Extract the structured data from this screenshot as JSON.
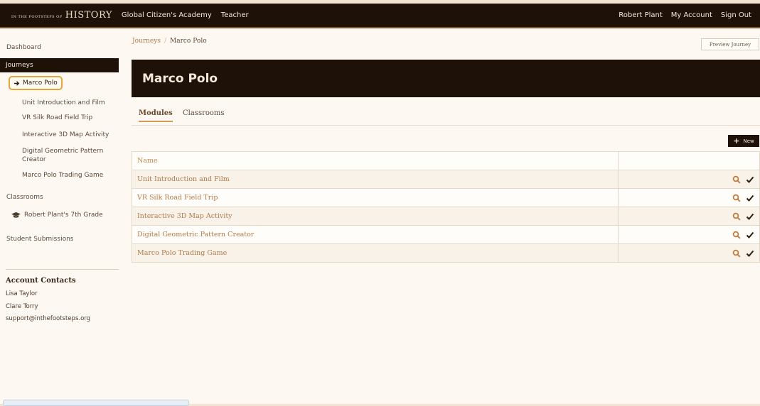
{
  "nav": {
    "brand_small": "In The Footsteps Of",
    "brand_big": "History",
    "school": "Global Citizen's Academy",
    "role": "Teacher",
    "user": "Robert Plant",
    "my_account": "My Account",
    "sign_out": "Sign Out"
  },
  "sidebar": {
    "dashboard": "Dashboard",
    "journeys": "Journeys",
    "active_journey": "Marco Polo",
    "journey_items": [
      "Unit Introduction and Film",
      "VR Silk Road Field Trip",
      "Interactive 3D Map Activity",
      "Digital Geometric Pattern Creator",
      "Marco Polo Trading Game"
    ],
    "classrooms": "Classrooms",
    "classroom": "Robert Plant's 7th Grade",
    "submissions": "Student Submissions",
    "contacts_title": "Account Contacts",
    "contacts": [
      "Lisa Taylor",
      "Clare Torry",
      "support@inthefootsteps.org"
    ]
  },
  "breadcrumb": {
    "parent": "Journeys",
    "separator": "/",
    "current": "Marco Polo"
  },
  "preview_button": "Preview Journey",
  "page_title": "Marco Polo",
  "tabs": [
    "Modules",
    "Classrooms"
  ],
  "new_button": "New",
  "table": {
    "header": "Name",
    "rows": [
      "Unit Introduction and Film",
      "VR Silk Road Field Trip",
      "Interactive 3D Map Activity",
      "Digital Geometric Pattern Creator",
      "Marco Polo Trading Game"
    ]
  },
  "colors": {
    "dark": "#1e1208",
    "accent": "#e5a53c",
    "link": "#b07a49"
  }
}
